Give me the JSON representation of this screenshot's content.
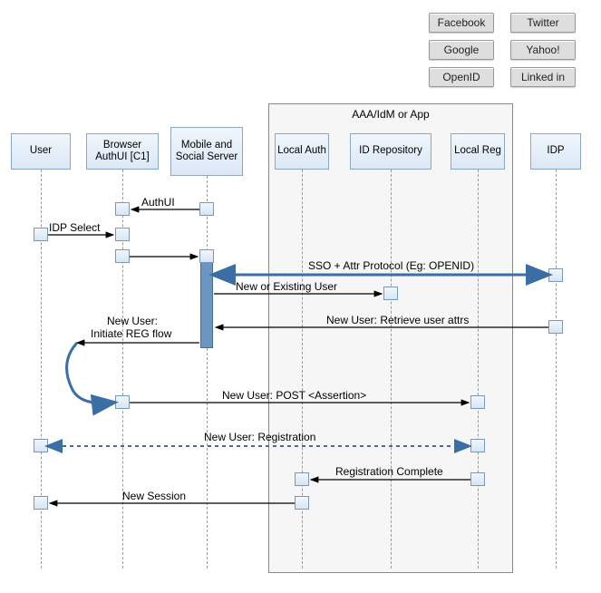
{
  "chart_data": {
    "type": "sequence",
    "title": "",
    "idp_buttons": [
      [
        "Facebook",
        "Twitter"
      ],
      [
        "Google",
        "Yahoo!"
      ],
      [
        "OpenID",
        "Linked in"
      ]
    ],
    "container": {
      "label": "AAA/IdM or App"
    },
    "participants": [
      "User",
      "Browser AuthUI [C1]",
      "Mobile and Social Server",
      "Local Auth",
      "ID Repository",
      "Local Reg",
      "IDP"
    ],
    "messages": [
      {
        "from": "Mobile and Social Server",
        "to": "Browser AuthUI [C1]",
        "label": "AuthUI"
      },
      {
        "from": "User",
        "to": "Browser AuthUI [C1]",
        "label": "IDP Select"
      },
      {
        "from": "Browser AuthUI [C1]",
        "to": "Mobile and Social Server",
        "label": ""
      },
      {
        "from": "Mobile and Social Server",
        "to": "IDP",
        "label": "SSO + Attr Protocol (Eg: OPENID)",
        "style": "double-thick",
        "return": true
      },
      {
        "from": "Mobile and Social Server",
        "to": "ID Repository",
        "label": "New or Existing User"
      },
      {
        "from": "IDP",
        "to": "Mobile and Social Server",
        "label": "New User: Retrieve user attrs"
      },
      {
        "from": "Mobile and Social Server",
        "to": "Browser AuthUI [C1]",
        "label": "New User: Initiate REG flow",
        "style": "self-curve"
      },
      {
        "from": "Browser AuthUI [C1]",
        "to": "Local Reg",
        "label": "New User: POST <Assertion>"
      },
      {
        "from": "User",
        "to": "Local Reg",
        "label": "New User: Registration",
        "style": "dashed-double",
        "return": true
      },
      {
        "from": "Local Reg",
        "to": "Local Auth",
        "label": "Registration Complete"
      },
      {
        "from": "Local Auth",
        "to": "User",
        "label": "New Session"
      }
    ]
  },
  "idp": {
    "r0c0": "Facebook",
    "r0c1": "Twitter",
    "r1c0": "Google",
    "r1c1": "Yahoo!",
    "r2c0": "OpenID",
    "r2c1": "Linked in"
  },
  "container_label": "AAA/IdM or App",
  "participants": {
    "user": "User",
    "browser": "Browser AuthUI [C1]",
    "server": "Mobile and Social Server",
    "localauth": "Local Auth",
    "idrepo": "ID Repository",
    "localreg": "Local Reg",
    "idp": "IDP"
  },
  "msg": {
    "authui": "AuthUI",
    "idpselect": "IDP Select",
    "sso": "SSO + Attr Protocol (Eg: OPENID)",
    "newexist": "New or Existing User",
    "retrieve": "New User: Retrieve user attrs",
    "initiate1": "New User:",
    "initiate2": "Initiate REG flow",
    "post": "New User: POST <Assertion>",
    "registration": "New User: Registration",
    "regcomplete": "Registration Complete",
    "newsession": "New Session"
  }
}
